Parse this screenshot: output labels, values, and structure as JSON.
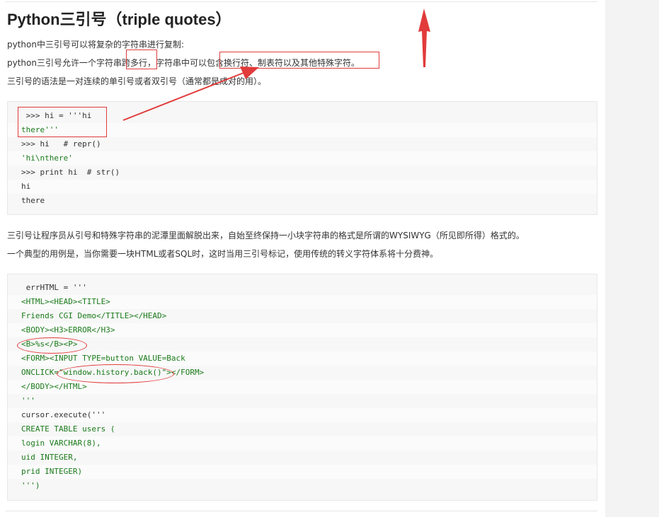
{
  "article": {
    "title": "Python三引号（triple quotes）",
    "para1": "python中三引号可以将复杂的字符串进行复制:",
    "para2": "python三引号允许一个字符串跨多行，字符串中可以包含换行符、制表符以及其他特殊字符。",
    "para3": "三引号的语法是一对连续的单引号或者双引号（通常都是成对的用）。",
    "para4": "三引号让程序员从引号和特殊字符串的泥潭里面解脱出来，自始至终保持一小块字符串的格式是所谓的WYSIWYG（所见即所得）格式的。",
    "para5": "一个典型的用例是，当你需要一块HTML或者SQL时，这时当用三引号标记，使用传统的转义字符体系将十分费神。"
  },
  "code1": [
    " >>> hi = '''hi",
    "there'''",
    ">>> hi   # repr()",
    "'hi\\nthere'",
    ">>> print hi  # str()",
    "hi",
    "there"
  ],
  "code2": [
    " errHTML = '''",
    "<HTML><HEAD><TITLE>",
    "Friends CGI Demo</TITLE></HEAD>",
    "<BODY><H3>ERROR</H3>",
    "<B>%s</B><P>",
    "<FORM><INPUT TYPE=button VALUE=Back",
    "ONCLICK=\"window.history.back()\"></FORM>",
    "</BODY></HTML>",
    "'''",
    "cursor.execute('''",
    "CREATE TABLE users (",
    "login VARCHAR(8),",
    "uid INTEGER,",
    "prid INTEGER)",
    "''')"
  ],
  "colors": {
    "annotation_red": "#e23b3b",
    "code_green": "#1a7a1a",
    "code_black": "#333333"
  }
}
